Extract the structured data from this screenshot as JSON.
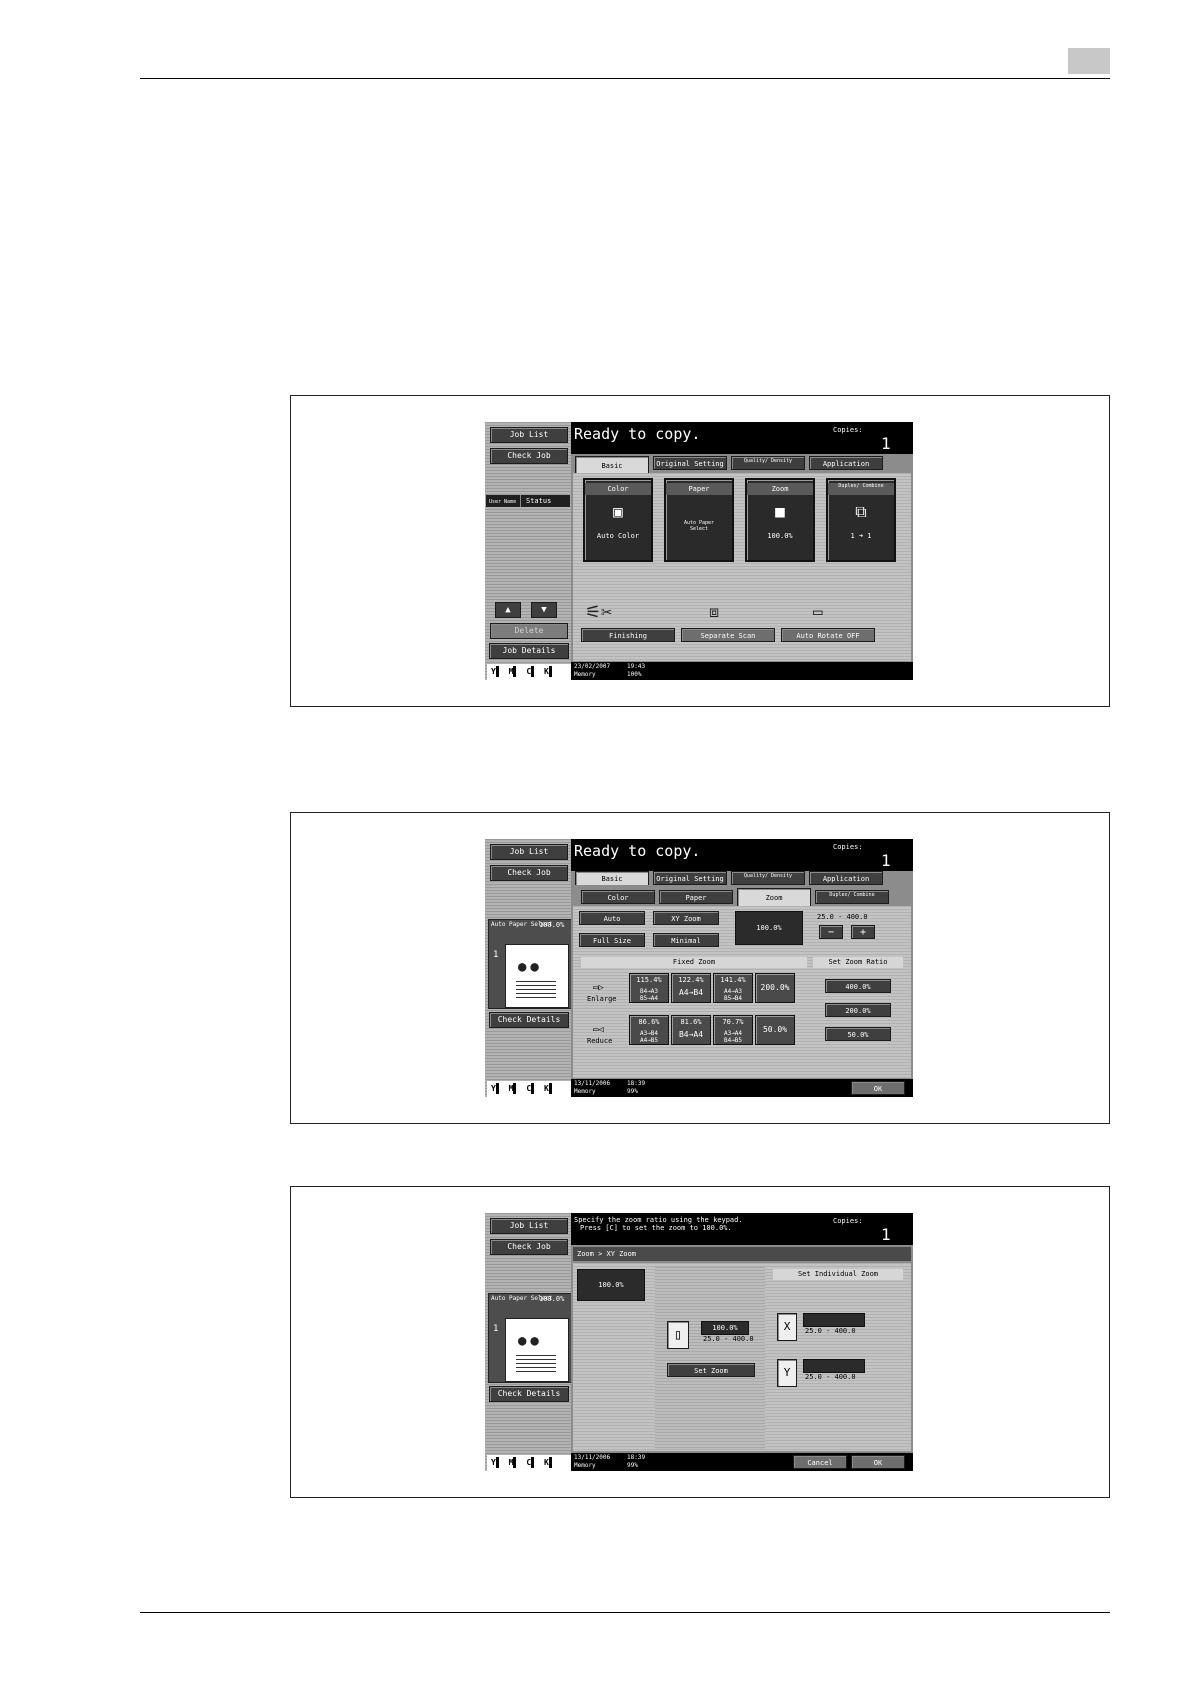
{
  "figures": [
    {
      "left": {
        "job_list": "Job List",
        "check_job": "Check Job",
        "col_user": "User Name",
        "col_status": "Status",
        "up": "▲",
        "down": "▼",
        "delete": "Delete",
        "job_details": "Job Details"
      },
      "header": {
        "title": "Ready to copy.",
        "copies_label": "Copies:",
        "copies": "1"
      },
      "tabs": [
        "Basic",
        "Original Setting",
        "Quality/ Density",
        "Application"
      ],
      "big_buttons": [
        {
          "label": "Color",
          "value": "Auto Color",
          "icon": "▣"
        },
        {
          "label": "Paper",
          "value": "Auto Paper Select",
          "icon": ""
        },
        {
          "label": "Zoom",
          "value": "100.0%",
          "icon": "■"
        },
        {
          "label": "Duplex/ Combine",
          "value": "1 ➜ 1",
          "icon": "⧉"
        }
      ],
      "func": [
        "Finishing",
        "Separate Scan",
        "Auto Rotate OFF"
      ],
      "footer": {
        "date": "23/02/2007",
        "time": "19:43",
        "mem_label": "Memory",
        "mem": "100%"
      },
      "ymck": [
        "Y",
        "M",
        "C",
        "K"
      ]
    },
    {
      "left": {
        "job_list": "Job List",
        "check_job": "Check Job",
        "thumb_label": "Auto Paper Select",
        "thumb_pct": "100.0%",
        "side": "1",
        "check_details": "Check Details"
      },
      "header": {
        "title": "Ready to copy.",
        "copies_label": "Copies:",
        "copies": "1"
      },
      "tabs": [
        "Basic",
        "Original Setting",
        "Quality/ Density",
        "Application"
      ],
      "subtabs": [
        "Color",
        "Paper",
        "Zoom",
        "Duplex/ Combine"
      ],
      "zoom_btns": [
        "Auto",
        "XY Zoom",
        "Full Size",
        "Minimal"
      ],
      "zoom_value": "100.0%",
      "range": "25.0  -  400.0",
      "minus": "−",
      "plus": "+",
      "fixed_zoom": "Fixed Zoom",
      "enlarge": "Enlarge",
      "reduce": "Reduce",
      "enlarge_cells": [
        {
          "pct": "115.4%",
          "size": "B4→A3 B5→A4"
        },
        {
          "pct": "122.4%",
          "size": "A4→B4"
        },
        {
          "pct": "141.4%",
          "size": "A4→A3 B5→B4"
        },
        {
          "pct": "200.0%",
          "size": ""
        }
      ],
      "reduce_cells": [
        {
          "pct": "86.6%",
          "size": "A3→B4 A4→B5"
        },
        {
          "pct": "81.6%",
          "size": "B4→A4"
        },
        {
          "pct": "70.7%",
          "size": "A3→A4 B4→B5"
        },
        {
          "pct": "50.0%",
          "size": ""
        }
      ],
      "set_zoom_ratio": "Set Zoom Ratio",
      "presets": [
        "400.0%",
        "200.0%",
        "50.0%"
      ],
      "ok": "OK",
      "footer": {
        "date": "13/11/2006",
        "time": "18:39",
        "mem_label": "Memory",
        "mem": "99%"
      },
      "ymck": [
        "Y",
        "M",
        "C",
        "K"
      ]
    },
    {
      "left": {
        "job_list": "Job List",
        "check_job": "Check Job",
        "thumb_label": "Auto Paper Select",
        "thumb_pct": "100.0%",
        "side": "1",
        "check_details": "Check Details"
      },
      "header": {
        "msg1": "Specify the zoom ratio using the keypad.",
        "msg2": "Press [C] to set the zoom to 100.0%.",
        "copies_label": "Copies:",
        "copies": "1"
      },
      "breadcrumb": "Zoom > XY Zoom",
      "zoom_value": "100.0%",
      "main_zoom": "100.0%",
      "range": "25.0  -  400.0",
      "set_zoom": "Set Zoom",
      "individual": "Set Individual Zoom",
      "x_label": "X",
      "y_label": "Y",
      "cancel": "Cancel",
      "ok": "OK",
      "footer": {
        "date": "13/11/2006",
        "time": "18:39",
        "mem_label": "Memory",
        "mem": "99%"
      },
      "ymck": [
        "Y",
        "M",
        "C",
        "K"
      ]
    }
  ]
}
